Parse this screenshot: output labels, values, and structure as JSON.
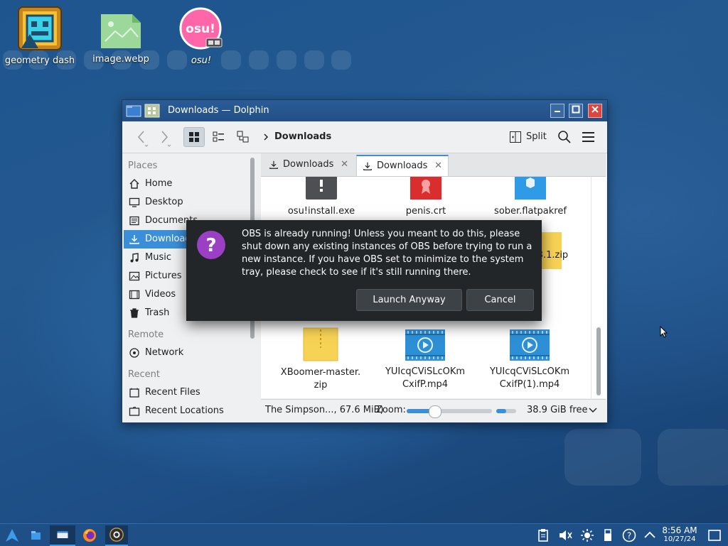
{
  "desktop": {
    "icons": [
      {
        "label": "geometry dash",
        "icon": "geometry-dash-icon"
      },
      {
        "label": "image.webp",
        "icon": "image-file-icon"
      },
      {
        "label": "osu!",
        "icon": "osu-icon",
        "badge": "▭▭"
      }
    ]
  },
  "window": {
    "title": "Downloads — Dolphin",
    "breadcrumb": "Downloads",
    "split_label": "Split",
    "places": {
      "header_places": "Places",
      "items_places": [
        {
          "label": "Home",
          "icon": "home-icon"
        },
        {
          "label": "Desktop",
          "icon": "desktop-icon"
        },
        {
          "label": "Documents",
          "icon": "documents-icon"
        },
        {
          "label": "Downloads",
          "icon": "downloads-icon",
          "selected": true
        },
        {
          "label": "Music",
          "icon": "music-icon"
        },
        {
          "label": "Pictures",
          "icon": "pictures-icon"
        },
        {
          "label": "Videos",
          "icon": "videos-icon"
        },
        {
          "label": "Trash",
          "icon": "trash-icon"
        }
      ],
      "header_remote": "Remote",
      "items_remote": [
        {
          "label": "Network",
          "icon": "network-icon"
        }
      ],
      "header_recent": "Recent",
      "items_recent": [
        {
          "label": "Recent Files",
          "icon": "recent-files-icon"
        },
        {
          "label": "Recent Locations",
          "icon": "recent-locations-icon"
        }
      ]
    },
    "tabs": [
      {
        "label": "Downloads",
        "active": false
      },
      {
        "label": "Downloads",
        "active": true
      }
    ],
    "files": [
      {
        "name1": "osu!install.exe",
        "name2": "",
        "icon": "executable-icon"
      },
      {
        "name1": "penis.crt",
        "name2": "",
        "icon": "certificate-icon"
      },
      {
        "name1": "sober.flatpakref",
        "name2": "",
        "icon": "package-icon"
      },
      {
        "name1": "-3.1.zip",
        "name2": "",
        "icon": "zip-icon"
      },
      {
        "name1": "XBoomer-master.",
        "name2": "zip",
        "icon": "zip-icon"
      },
      {
        "name1": "YUIcqCViSLcOKm",
        "name2": "CxifP.mp4",
        "icon": "video-file-icon"
      },
      {
        "name1": "YUIcqCViSLcOKm",
        "name2": "CxifP(1).mp4",
        "icon": "video-file-icon"
      }
    ],
    "status": {
      "selection": "The Simpson..., 67.6 MiB)",
      "zoom_label": "Zoom:",
      "zoom_level": 0.3,
      "free_space": "38.9 GiB free"
    }
  },
  "dialog": {
    "message": "OBS is already running! Unless you meant to do this, please shut down any existing instances of OBS before trying to run a new instance. If you have OBS set to minimize to the system tray, please check to see if it's still running there.",
    "launch_label": "Launch Anyway",
    "cancel_label": "Cancel",
    "icon": "question-icon"
  },
  "taskbar": {
    "time": "8:56 AM",
    "date": "10/27/24",
    "items": [
      "application-launcher-icon",
      "file-manager-icon",
      "dolphin-task-icon",
      "firefox-icon",
      "obs-icon"
    ],
    "tray": [
      "clipboard-icon",
      "volume-muted-icon",
      "brightness-icon",
      "usb-icon",
      "help-icon",
      "tray-expand-icon",
      "show-desktop-icon"
    ]
  },
  "colors": {
    "accent": "#3b8fd8",
    "dialog_bg": "#232629",
    "taskbar_bg": "#1f4f87"
  }
}
